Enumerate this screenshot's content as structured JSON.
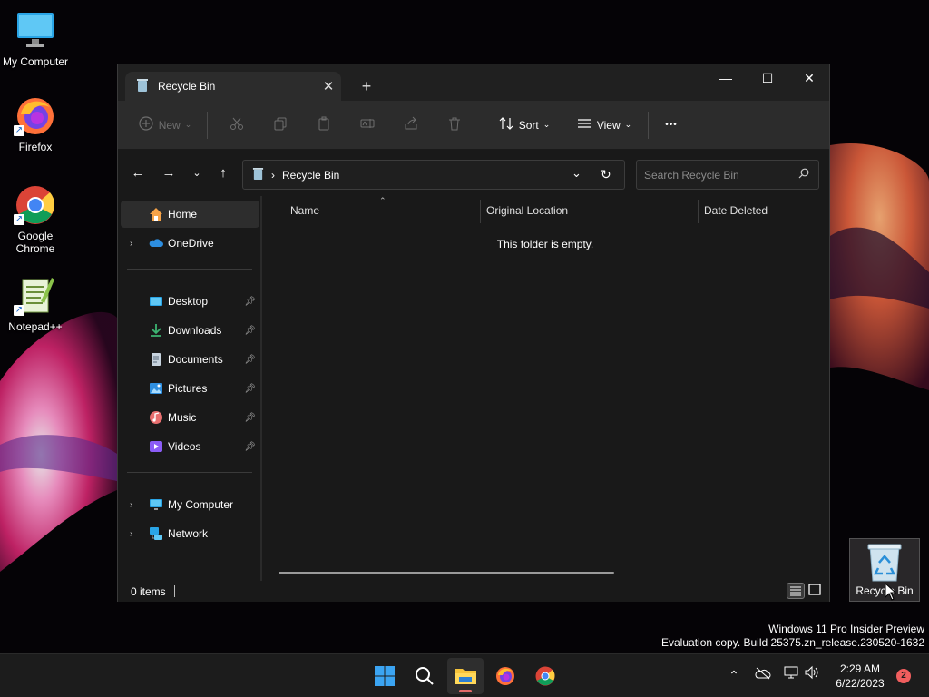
{
  "desktop": {
    "icons": [
      {
        "label": "My Computer",
        "icon": "monitor-icon"
      },
      {
        "label": "Firefox",
        "icon": "firefox-icon"
      },
      {
        "label": "Google Chrome",
        "icon": "chrome-icon"
      },
      {
        "label": "Notepad++",
        "icon": "notepadpp-icon"
      },
      {
        "label": "Recycle Bin",
        "icon": "recycle-bin-icon"
      }
    ],
    "watermark": {
      "line1": "Windows 11 Pro Insider Preview",
      "line2": "Evaluation copy. Build 25375.zn_release.230520-1632"
    }
  },
  "window": {
    "tab": {
      "label": "Recycle Bin",
      "close": "✕"
    },
    "new_tab": "+",
    "controls": {
      "minimize": "—",
      "maximize": "☐",
      "close": "✕"
    },
    "toolbar": {
      "new_label": "New",
      "sort_label": "Sort",
      "view_label": "View",
      "more_label": "•••"
    },
    "address": {
      "separator": "›",
      "location": "Recycle Bin"
    },
    "search": {
      "placeholder": "Search Recycle Bin"
    },
    "sidebar": {
      "home": "Home",
      "onedrive": "OneDrive",
      "quick_access": [
        {
          "label": "Desktop",
          "icon": "desktop-icon"
        },
        {
          "label": "Downloads",
          "icon": "downloads-icon"
        },
        {
          "label": "Documents",
          "icon": "documents-icon"
        },
        {
          "label": "Pictures",
          "icon": "pictures-icon"
        },
        {
          "label": "Music",
          "icon": "music-icon"
        },
        {
          "label": "Videos",
          "icon": "videos-icon"
        }
      ],
      "my_computer": "My Computer",
      "network": "Network"
    },
    "columns": {
      "name": "Name",
      "original_location": "Original Location",
      "date_deleted": "Date Deleted"
    },
    "empty_message": "This folder is empty.",
    "status": {
      "items": "0 items"
    }
  },
  "taskbar": {
    "clock": {
      "time": "2:29 AM",
      "date": "6/22/2023"
    },
    "notification_count": "2",
    "accent": "#e36a6a"
  }
}
